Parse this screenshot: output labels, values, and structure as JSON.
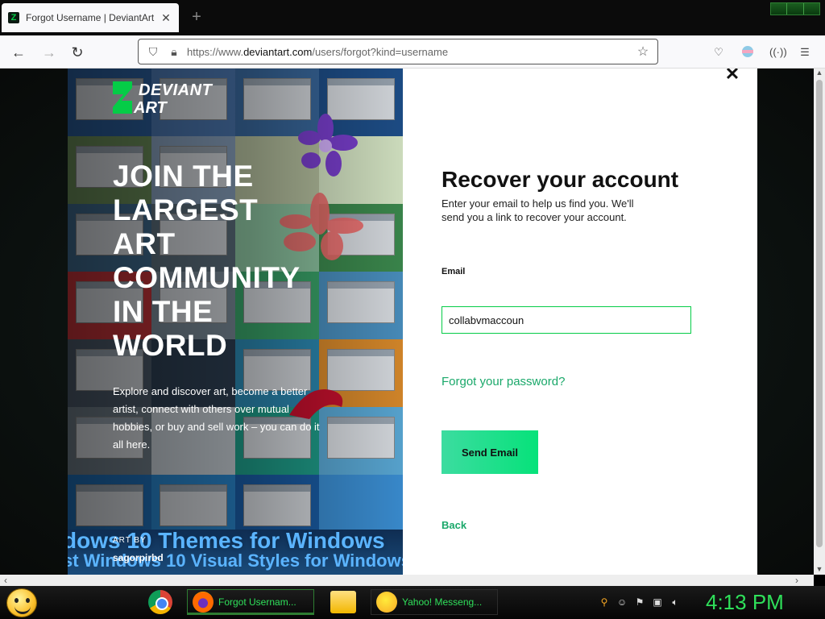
{
  "browser": {
    "tab_title": "Forgot Username | DeviantArt",
    "new_tab_symbol": "+",
    "url_prefix": "https://www.",
    "url_domain": "deviantart.com",
    "url_path": "/users/forgot?kind=username"
  },
  "art_panel": {
    "logo_line1": "DEVIANT",
    "logo_line2": "ART",
    "headline_lines": [
      "JOIN THE",
      "LARGEST",
      "ART",
      "COMMUNITY",
      "IN THE",
      "WORLD"
    ],
    "subcopy": "Explore and discover art, become a better artist, connect with others over mutual hobbies, or buy and sell work – you can do it all here.",
    "banner_line1": "dows 10 Themes for Windows",
    "banner_line2": "st Windows 10 Visual Styles for Windows",
    "credit_label": "ART BY",
    "credit_name": "sagorpirbd"
  },
  "form": {
    "title": "Recover your account",
    "description": "Enter your email to help us find you. We'll send you a link to recover your account.",
    "email_label": "Email",
    "email_value": "collabvmaccoun",
    "forgot_password_link": "Forgot your password?",
    "send_button": "Send Email",
    "back_link": "Back"
  },
  "taskbar": {
    "firefox_item": "Forgot Usernam...",
    "yahoo_item": "Yahoo! Messeng...",
    "clock": "4:13 PM"
  },
  "colors": {
    "accent_green": "#05cc47",
    "link_green": "#1aa86a",
    "clock_green": "#2fe05a"
  },
  "icons": [
    "deviantart-favicon",
    "close-icon",
    "plus-icon",
    "back-arrow-icon",
    "forward-arrow-icon",
    "reload-icon",
    "shield-icon",
    "lock-icon",
    "bookmark-star-icon",
    "pocket-icon",
    "account-icon",
    "extension-icon",
    "menu-icon",
    "chrome-icon",
    "firefox-icon",
    "folder-icon",
    "yahoo-messenger-icon",
    "search-icon",
    "speaker-icon"
  ]
}
